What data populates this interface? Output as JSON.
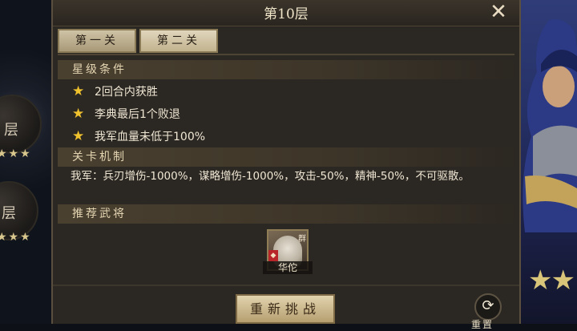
{
  "background": {
    "left_floors": [
      {
        "label": "层",
        "stars": "★★★"
      },
      {
        "label": "层",
        "stars": "★★★"
      }
    ],
    "right_stars": "★★"
  },
  "dialog": {
    "title": "第10层",
    "close_icon": "close-x-icon",
    "tabs": [
      {
        "label": "第一关",
        "active": false
      },
      {
        "label": "第二关",
        "active": true
      }
    ],
    "star_conditions": {
      "heading": "星级条件",
      "items": [
        "2回合内获胜",
        "李典最后1个败退",
        "我军血量未低于100%"
      ]
    },
    "mechanics": {
      "heading": "关卡机制",
      "text": "我军：兵刃增伤-1000%，谋略增伤-1000%，攻击-50%，精神-50%，不可驱散。"
    },
    "recommended": {
      "heading": "推荐武将",
      "heroes": [
        {
          "name": "华佗",
          "faction": "群"
        }
      ]
    },
    "retry_label": "重新挑战",
    "reset_label": "重置"
  },
  "colors": {
    "star": "#f0c22e",
    "panel": "#2b2722",
    "button": "#cdb98a"
  }
}
